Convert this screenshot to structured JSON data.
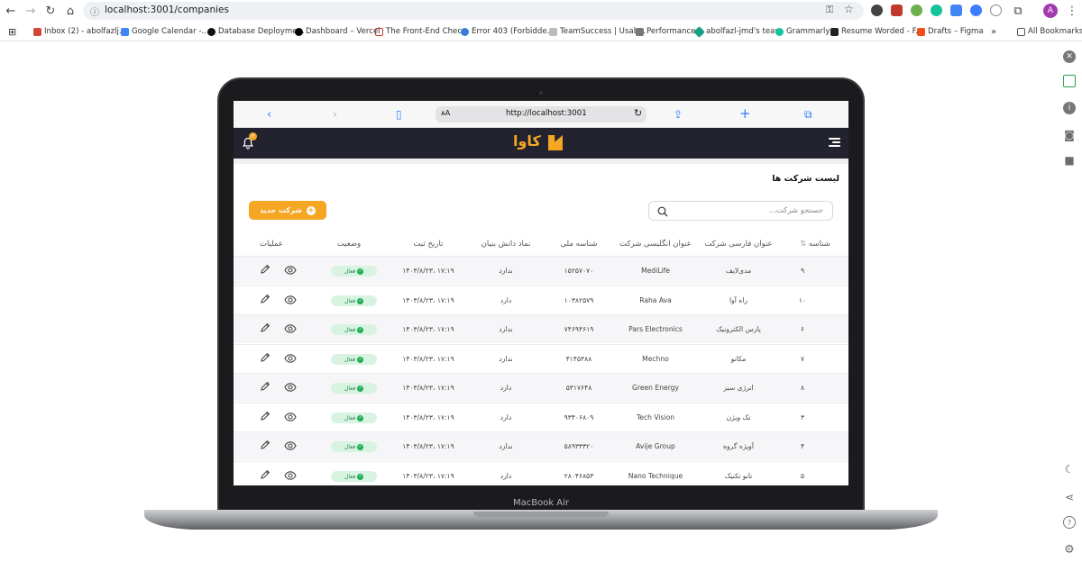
{
  "browser": {
    "url": "localhost:3001/companies",
    "bookmarks": [
      "Inbox (2) - abolfazlj...",
      "Google Calendar -...",
      "Database Deployme...",
      "Dashboard – Vercel",
      "The Front-End Chec...",
      "Error 403 (Forbidde...",
      "TeamSuccess | Usab...",
      "Performance",
      "abolfazl-jmd's team",
      "Grammarly",
      "Resume Worded - F...",
      "Drafts – Figma"
    ],
    "bookmarks_overflow": "»",
    "all_bookmarks": "All Bookmarks",
    "profile_initial": "A"
  },
  "device": {
    "label": "MacBook Air"
  },
  "safari": {
    "aa": "ᴀA",
    "url": "http://localhost:3001"
  },
  "app": {
    "logo": "کاوا",
    "notification_count": "۳",
    "page_title": "لیست شرکت ها",
    "new_company_label": "شرکت جدید",
    "search_placeholder": "جستجو شرکت...",
    "columns": [
      "شناسه",
      "عنوان فارسی شرکت",
      "عنوان انگلیسی شرکت",
      "شناسه ملی",
      "نماد دانش بنیان",
      "تاریخ ثبت",
      "وضعیت",
      "عملیات"
    ],
    "sort_icon": "⇅",
    "rows": [
      {
        "id": "۹",
        "fa": "مدی‌لایف",
        "en": "MediLife",
        "national_id": "۱۵۲۵۷۰۷۰",
        "kb": "ندارد",
        "date": "۱۴۰۳/۸/۲۳، ۱۷:۱۹",
        "status": "فعال"
      },
      {
        "id": "۱۰",
        "fa": "راه آوا",
        "en": "Raha Ava",
        "national_id": "۱۰۳۸۲۵۷۹",
        "kb": "دارد",
        "date": "۱۴۰۳/۸/۲۳، ۱۷:۱۹",
        "status": "فعال"
      },
      {
        "id": "۶",
        "fa": "پارس الکترونیک",
        "en": "Pars Electronics",
        "national_id": "۷۴۶۹۴۶۱۹",
        "kb": "ندارد",
        "date": "۱۴۰۳/۸/۲۳، ۱۷:۱۹",
        "status": "فعال"
      },
      {
        "id": "۷",
        "fa": "مکانو",
        "en": "Mechno",
        "national_id": "۴۱۴۵۳۸۸",
        "kb": "ندارد",
        "date": "۱۴۰۳/۸/۲۳، ۱۷:۱۹",
        "status": "فعال"
      },
      {
        "id": "۸",
        "fa": "انرژی سبز",
        "en": "Green Energy",
        "national_id": "۵۳۱۷۶۴۸",
        "kb": "دارد",
        "date": "۱۴۰۳/۸/۲۳، ۱۷:۱۹",
        "status": "فعال"
      },
      {
        "id": "۳",
        "fa": "تک ویژن",
        "en": "Tech Vision",
        "national_id": "۹۳۴۰۶۸۰۹",
        "kb": "دارد",
        "date": "۱۴۰۳/۸/۲۳، ۱۷:۱۹",
        "status": "فعال"
      },
      {
        "id": "۴",
        "fa": "آویژه گروه",
        "en": "Avije Group",
        "national_id": "۵۸۹۳۳۳۲۰",
        "kb": "ندارد",
        "date": "۱۴۰۳/۸/۲۳، ۱۷:۱۹",
        "status": "فعال"
      },
      {
        "id": "۵",
        "fa": "نانو تکنیک",
        "en": "Nano Technique",
        "national_id": "۲۸۰۴۶۸۵۳",
        "kb": "دارد",
        "date": "۱۴۰۳/۸/۲۳، ۱۷:۱۹",
        "status": "فعال"
      }
    ]
  },
  "colors": {
    "accent": "#f5a623",
    "header": "#23232f",
    "active": "#1fae55"
  }
}
